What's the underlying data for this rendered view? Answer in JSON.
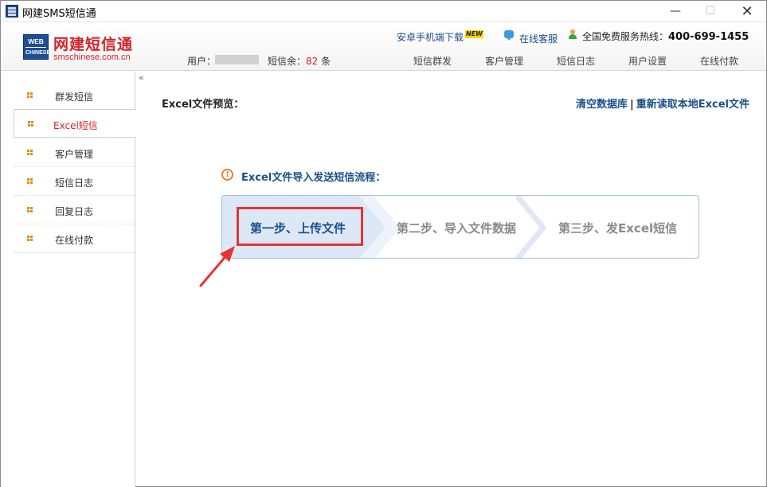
{
  "window": {
    "title": "网建SMS短信通",
    "controls": {
      "minimize": "—",
      "maximize": "☐",
      "close": "✕"
    }
  },
  "brand": {
    "badge_top": "WEB",
    "badge_bottom": "CHINESE",
    "name": "网建短信通",
    "url": "smschinese.com.cn"
  },
  "account": {
    "user_label": "用户：",
    "balance_label": "短信余：",
    "balance_value": "82",
    "balance_unit": "条"
  },
  "top_links": {
    "android": "安卓手机端下载",
    "new_badge": "NEW",
    "service": "在线客服",
    "hotline_label": "全国免费服务热线：",
    "hotline_number": "400-699-1455"
  },
  "nav": [
    "短信群发",
    "客户管理",
    "短信日志",
    "用户设置",
    "在线付款"
  ],
  "sidebar": {
    "collapse": "«",
    "items": [
      {
        "label": "群发短信",
        "active": false
      },
      {
        "label": "Excel短信",
        "active": true
      },
      {
        "label": "客户管理",
        "active": false
      },
      {
        "label": "短信日志",
        "active": false
      },
      {
        "label": "回复日志",
        "active": false
      },
      {
        "label": "在线付款",
        "active": false
      }
    ]
  },
  "main": {
    "preview_title": "Excel文件预览：",
    "clear_db": "清空数据库",
    "separator": "|",
    "reload_excel": "重新读取本地Excel文件",
    "warn_glyph": "!",
    "flow_title": "Excel文件导入发送短信流程：",
    "steps": [
      "第一步、上传文件",
      "第二步、导入文件数据",
      "第三步、发Excel短信"
    ]
  },
  "colors": {
    "brand_red": "#d3242a",
    "link_blue": "#1a4f8a",
    "bullet_orange": "#e08a1e",
    "highlight_red": "#e53335"
  },
  "icons": [
    "app-logo-icon",
    "chat-bubble-icon",
    "person-icon",
    "warning-circle-icon",
    "red-pointer-arrow-icon"
  ]
}
